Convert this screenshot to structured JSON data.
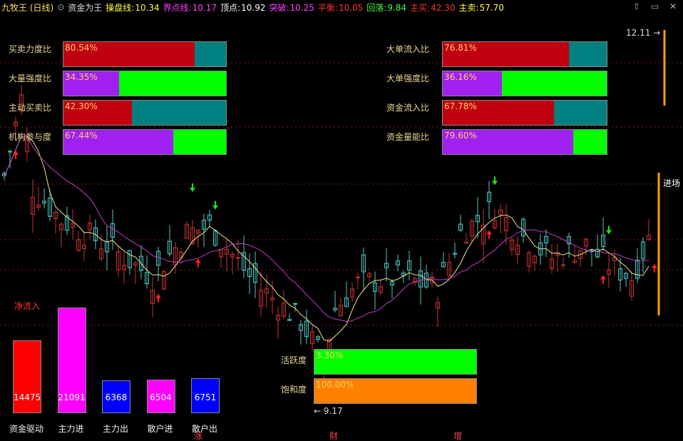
{
  "header": {
    "title": "九牧王 (日线)",
    "indicator": "资金为王",
    "fields": [
      {
        "label": "操盘线:",
        "value": "10.34",
        "color": "#ffff40"
      },
      {
        "label": "界点线:",
        "value": "10.17",
        "color": "#ff40ff"
      },
      {
        "label": "顶点:",
        "value": "10.92",
        "color": "#ffffff"
      },
      {
        "label": "突破:",
        "value": "10.25",
        "color": "#ff40ff"
      },
      {
        "label": "平衡:",
        "value": "10.05",
        "color": "#ff3030"
      },
      {
        "label": "回落:",
        "value": "9.84",
        "color": "#40ff40"
      },
      {
        "label": "主买:",
        "value": "42.30",
        "color": "#ff3030"
      },
      {
        "label": "主卖:",
        "value": "57.70",
        "color": "#ffff40"
      }
    ]
  },
  "gauges_left": [
    {
      "label": "买卖力度比",
      "value": "80.54%",
      "fraction": 0.8054,
      "fill": "#c00010"
    },
    {
      "label": "大量强度比",
      "value": "34.35%",
      "fraction": 0.3435,
      "fill": "#a020f0",
      "rest": "#00ff00"
    },
    {
      "label": "主动买卖比",
      "value": "42.30%",
      "fraction": 0.423,
      "fill": "#c00010"
    },
    {
      "label": "机构参与度",
      "value": "67.44%",
      "fraction": 0.6744,
      "fill": "#a020f0",
      "rest": "#00ff00"
    }
  ],
  "gauges_right": [
    {
      "label": "大单流入比",
      "value": "76.81%",
      "fraction": 0.7681,
      "fill": "#c00010"
    },
    {
      "label": "大单强度比",
      "value": "36.16%",
      "fraction": 0.3616,
      "fill": "#a020f0",
      "rest": "#00ff00"
    },
    {
      "label": "资金流入比",
      "value": "67.78%",
      "fraction": 0.6778,
      "fill": "#c00010"
    },
    {
      "label": "资金量能比",
      "value": "79.60%",
      "fraction": 0.796,
      "fill": "#a020f0",
      "rest": "#00ff00"
    }
  ],
  "gauges_bottom": [
    {
      "label": "活跃度",
      "value": "3.30%",
      "fill": "#00ff00"
    },
    {
      "label": "饱和度",
      "value": "100.00%",
      "fill": "#ff8000"
    }
  ],
  "netflow": {
    "title": "净流入",
    "bars": [
      {
        "label": "资金驱动",
        "value": 14475,
        "text": "14475",
        "color": "#ff0000"
      },
      {
        "label": "主力进",
        "value": 21091,
        "text": "21091",
        "color": "#ff00ff"
      },
      {
        "label": "主力出",
        "value": 6368,
        "text": "6368",
        "color": "#0000ff"
      },
      {
        "label": "散户进",
        "value": 6504,
        "text": "6504",
        "color": "#ff00ff"
      },
      {
        "label": "散户出",
        "value": 6751,
        "text": "6751",
        "color": "#0000ff"
      }
    ]
  },
  "annotations": {
    "high": "12.11",
    "low": "9.17",
    "entry": "进场",
    "bottom_marks": [
      "涨",
      "财",
      "增"
    ]
  }
}
